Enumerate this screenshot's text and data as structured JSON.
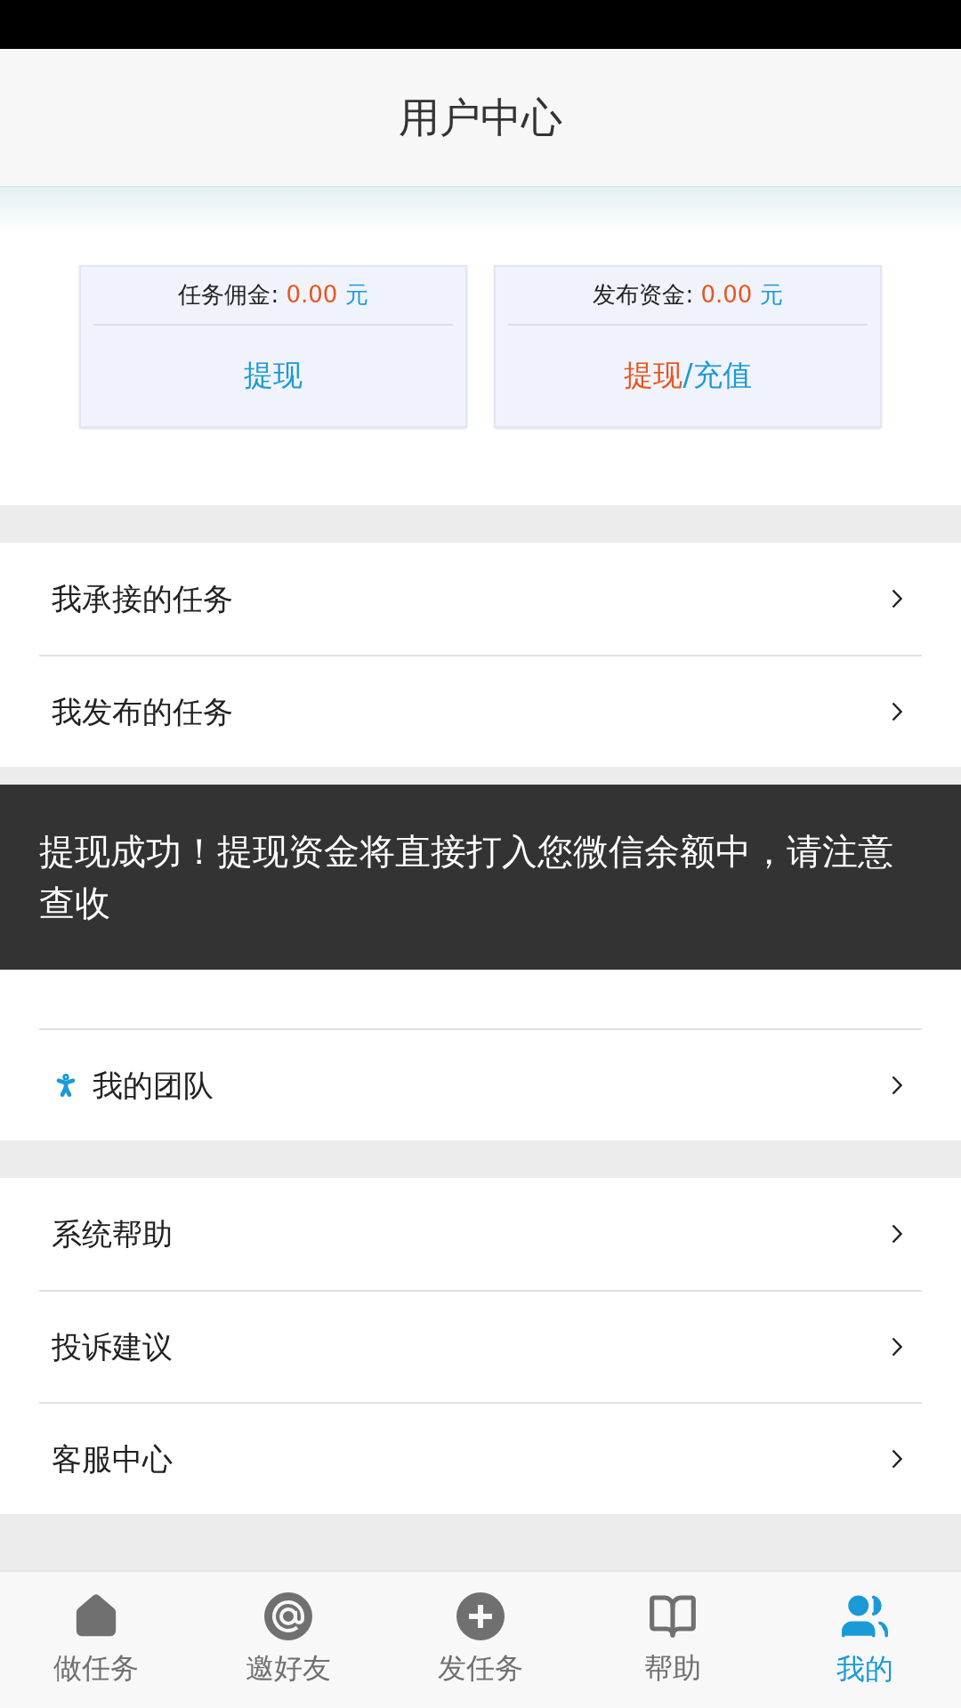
{
  "header": {
    "title": "用户中心"
  },
  "cards": [
    {
      "label": "任务佣金:",
      "amount": "0.00",
      "unit": "元",
      "actions": [
        {
          "text": "提现",
          "kind": "blue"
        }
      ]
    },
    {
      "label": "发布资金:",
      "amount": "0.00",
      "unit": "元",
      "actions": [
        {
          "text": "提现",
          "kind": "orange"
        },
        {
          "text": "/充值",
          "kind": "blue"
        }
      ]
    }
  ],
  "groups": [
    {
      "items": [
        {
          "label": "我承接的任务"
        },
        {
          "label": "我发布的任务"
        }
      ]
    },
    {
      "items": [
        {
          "label": "我的团队",
          "kind": "person"
        }
      ]
    },
    {
      "items": [
        {
          "label": "系统帮助"
        },
        {
          "label": "投诉建议"
        },
        {
          "label": "客服中心"
        }
      ]
    }
  ],
  "toast": {
    "text": "提现成功！提现资金将直接打入您微信余额中，请注意查收"
  },
  "tabs": [
    {
      "label": "做任务",
      "selected": false
    },
    {
      "label": "邀好友",
      "selected": false
    },
    {
      "label": "发任务",
      "selected": false
    },
    {
      "label": "帮助",
      "selected": false
    },
    {
      "label": "我的",
      "selected": true
    }
  ]
}
